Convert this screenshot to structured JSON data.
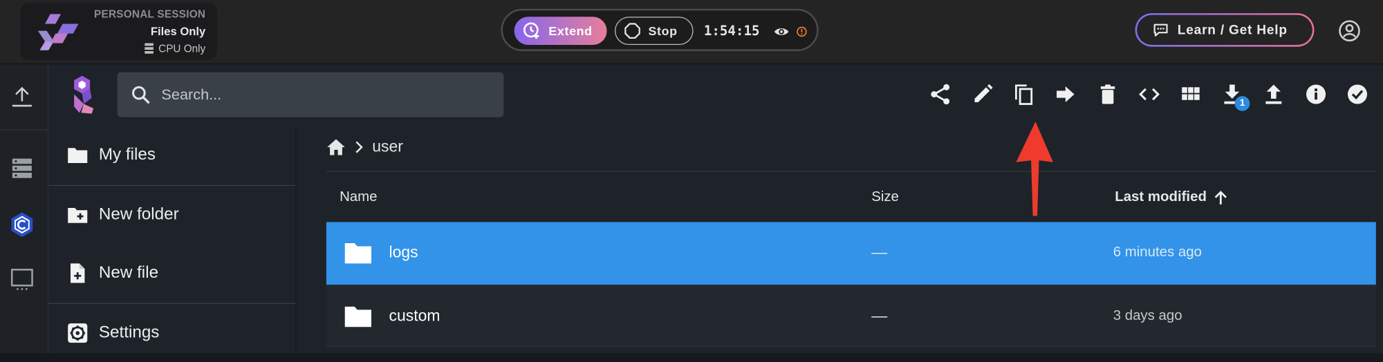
{
  "session": {
    "label": "PERSONAL SESSION",
    "mode": "Files Only",
    "hardware": "CPU Only"
  },
  "controls": {
    "extend_label": "Extend",
    "stop_label": "Stop",
    "timer": "1:54:15"
  },
  "help": {
    "label": "Learn / Get Help"
  },
  "search": {
    "placeholder": "Search..."
  },
  "toolbar": {
    "icons": [
      "share-icon",
      "edit-icon",
      "copy-icon",
      "move-icon",
      "delete-icon",
      "code-icon",
      "grid-view-icon",
      "download-icon",
      "upload-icon",
      "info-icon",
      "select-all-icon"
    ],
    "download_badge": "1"
  },
  "sidebar": {
    "items": [
      {
        "label": "My files",
        "icon": "folder-icon"
      },
      {
        "label": "New folder",
        "icon": "folder-plus-icon"
      },
      {
        "label": "New file",
        "icon": "file-plus-icon"
      },
      {
        "label": "Settings",
        "icon": "settings-icon"
      }
    ]
  },
  "breadcrumb": {
    "current": "user"
  },
  "table": {
    "columns": {
      "name": "Name",
      "size": "Size",
      "modified": "Last modified"
    },
    "rows": [
      {
        "name": "logs",
        "size": "—",
        "modified": "6 minutes ago",
        "selected": true
      },
      {
        "name": "custom",
        "size": "—",
        "modified": "3 days ago",
        "selected": false
      }
    ]
  },
  "colors": {
    "accent_blue": "#3293e8",
    "gradient_start": "#8766ea",
    "gradient_end": "#e67e9c",
    "annotation_arrow": "#ee3b2d"
  }
}
